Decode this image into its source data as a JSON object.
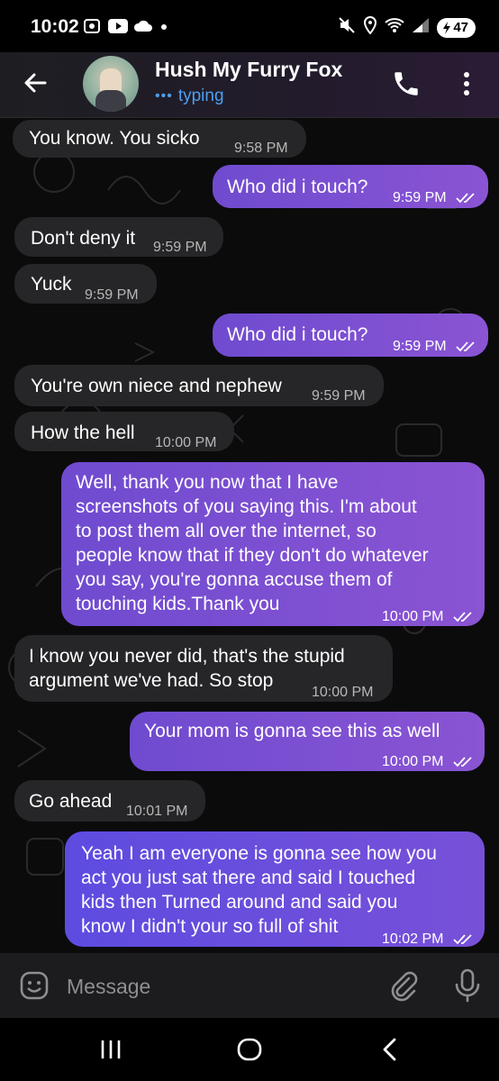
{
  "status_bar": {
    "time": "10:02",
    "battery": "47",
    "icons": [
      "screen-record-icon",
      "youtube-icon",
      "cloud-icon",
      "dot-icon",
      "mute-icon",
      "location-icon",
      "wifi-icon",
      "signal-icon",
      "battery-icon"
    ]
  },
  "header": {
    "name": "Hush My Furry Fox",
    "status": "typing",
    "accent": "#4c9ff1"
  },
  "messages": [
    {
      "dir": "in",
      "text": "You know.  You sicko",
      "time": "9:58 PM"
    },
    {
      "dir": "out",
      "text": "Who did i touch?",
      "time": "9:59 PM"
    },
    {
      "dir": "in",
      "text": "Don't deny it",
      "time": "9:59 PM"
    },
    {
      "dir": "in",
      "text": "Yuck",
      "time": "9:59 PM"
    },
    {
      "dir": "out",
      "text": "Who did i touch?",
      "time": "9:59 PM"
    },
    {
      "dir": "in",
      "text": "You're own niece and nephew",
      "time": "9:59 PM"
    },
    {
      "dir": "in",
      "text": "How the hell",
      "time": "10:00 PM"
    },
    {
      "dir": "out",
      "lines": [
        "Well, thank you now that I have",
        "screenshots of you saying this. I'm about",
        "to post them all over the internet, so",
        "people know that if they don't do whatever",
        "you say, you're gonna accuse them of",
        "touching kids.Thank you"
      ],
      "time": "10:00 PM"
    },
    {
      "dir": "in",
      "lines": [
        "I know you never did, that's the stupid",
        "argument we've had.  So stop"
      ],
      "time": "10:00 PM"
    },
    {
      "dir": "out",
      "text": "Your mom is gonna see this as well",
      "time": "10:00 PM"
    },
    {
      "dir": "in",
      "text": "Go ahead",
      "time": "10:01 PM"
    },
    {
      "dir": "out",
      "lines": [
        "Yeah I am everyone is gonna see how you",
        "act you just sat there and said I touched",
        "kids then Turned around and said you",
        "know I didn't your so full of shit"
      ],
      "time": "10:02 PM"
    }
  ],
  "input": {
    "placeholder": "Message"
  },
  "colors": {
    "incoming": "#262628",
    "outgoing": "#7d50d2",
    "background": "#0b0b0c"
  }
}
